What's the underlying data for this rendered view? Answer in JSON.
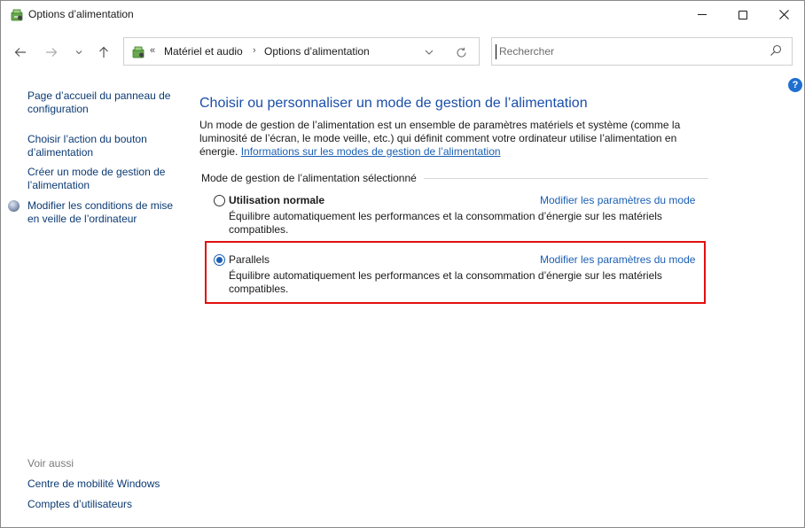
{
  "window": {
    "title": "Options d’alimentation",
    "controls": {
      "minimize": "minimize",
      "maximize": "maximize",
      "close": "close"
    }
  },
  "navigation": {
    "breadcrumb_overflow": "«",
    "breadcrumbs": [
      "Matériel et audio",
      "Options d’alimentation"
    ],
    "separator": "›",
    "search_placeholder": "Rechercher"
  },
  "sidebar": {
    "links": [
      "Page d’accueil du panneau de configuration",
      "Choisir l’action du bouton d’alimentation",
      "Créer un mode de gestion de l’alimentation",
      "Modifier les conditions de mise en veille de l’ordinateur"
    ],
    "see_also_label": "Voir aussi",
    "see_also_links": [
      "Centre de mobilité Windows",
      "Comptes d’utilisateurs"
    ]
  },
  "main": {
    "heading": "Choisir ou personnaliser un mode de gestion de l’alimentation",
    "intro": "Un mode de gestion de l’alimentation est un ensemble de paramètres matériels et système (comme la luminosité de l’écran, le mode veille, etc.) qui définit comment votre ordinateur utilise l’alimentation en énergie.",
    "info_link": "Informations sur les modes de gestion de l’alimentation",
    "section_label": "Mode de gestion de l’alimentation sélectionné",
    "plans": [
      {
        "name": "Utilisation normale",
        "selected": false,
        "link": "Modifier les paramètres du mode",
        "description": "Équilibre automatiquement les performances et la consommation d’énergie sur les matériels compatibles."
      },
      {
        "name": "Parallels",
        "selected": true,
        "link": "Modifier les paramètres du mode",
        "description": "Équilibre automatiquement les performances et la consommation d’énergie sur les matériels compatibles."
      }
    ]
  },
  "help": {
    "label": "?"
  },
  "colors": {
    "link": "#1a5fb4",
    "heading": "#1a4ea8",
    "highlight": "#e01010",
    "sidebar_link": "#0b3a73"
  }
}
